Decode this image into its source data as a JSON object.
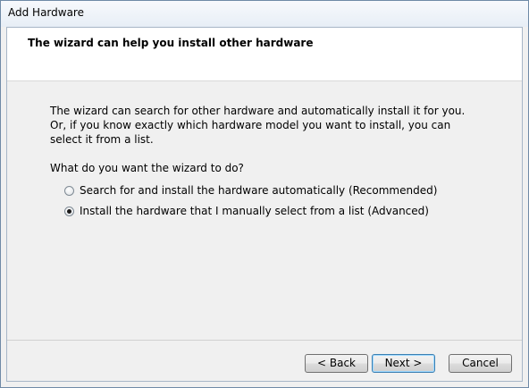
{
  "window": {
    "title": "Add Hardware"
  },
  "header": {
    "title": "The wizard can help you install other hardware"
  },
  "content": {
    "description": "The wizard can search for other hardware and automatically install it for you. Or, if you know exactly which hardware model you want to install, you can select it from a list.",
    "question": "What do you want the wizard to do?",
    "options": [
      {
        "label": "Search for and install the hardware automatically (Recommended)",
        "selected": false
      },
      {
        "label": "Install the hardware that I manually select from a list (Advanced)",
        "selected": true
      }
    ]
  },
  "buttons": {
    "back": "< Back",
    "next": "Next >",
    "cancel": "Cancel"
  },
  "colors": {
    "header_background": "#ffffff",
    "body_background": "#f0f0f0",
    "default_button_border": "#3c7fb1"
  }
}
